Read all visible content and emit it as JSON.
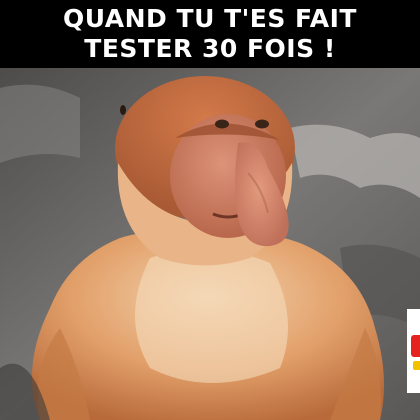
{
  "caption": {
    "line1": "QUAND TU T'ES FAIT",
    "line2": "TESTER 30 FOIS !"
  },
  "photo": {
    "subject": "proboscis-monkey",
    "colors": {
      "background_rock": "#6e6c6a",
      "fur": "#d9925a",
      "fur_light": "#f0cfa8",
      "face": "#c9765a",
      "nose": "#d2846a"
    }
  },
  "watermark": {
    "colors": {
      "red": "#e52420",
      "yellow": "#f2c200"
    }
  }
}
